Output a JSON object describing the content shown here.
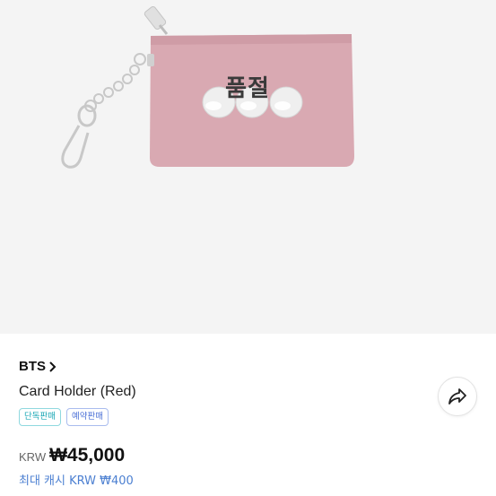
{
  "product": {
    "sold_out_label": "품절",
    "brand": "BTS",
    "title": "Card Holder (Red)",
    "badges": [
      "단독판매",
      "예약판매"
    ],
    "price": {
      "currency": "KRW",
      "amount": "₩45,000"
    },
    "cash_reward": "최대 캐시 KRW ₩400"
  },
  "icons": {
    "brand_chevron": "chevron-right-icon",
    "share": "share-arrow-icon"
  },
  "colors": {
    "card_holder": "#d9a9b2",
    "badge_teal": "#1aa7b5",
    "badge_blue": "#4a6fd6",
    "cash_text": "#4b7fd1"
  }
}
